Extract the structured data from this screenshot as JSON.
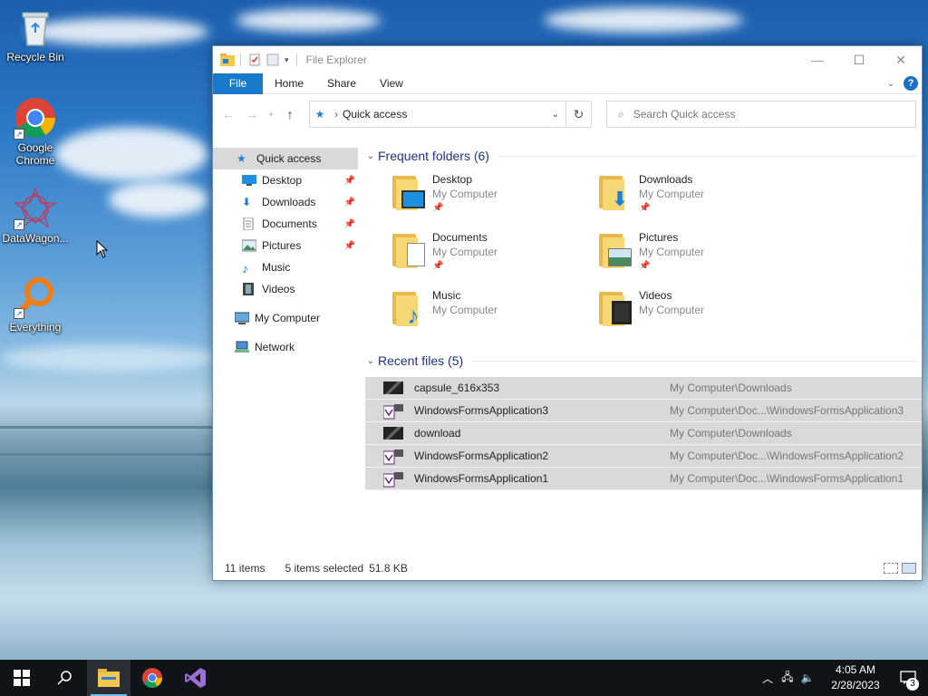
{
  "desktop": {
    "icons": [
      {
        "label": "Recycle Bin"
      },
      {
        "label": "Google Chrome"
      },
      {
        "label": "DataWagon..."
      },
      {
        "label": "Everything"
      }
    ]
  },
  "window": {
    "title": "File Explorer",
    "controls": {
      "minimize": "—",
      "maximize": "☐",
      "close": "✕"
    },
    "ribbon_tabs": [
      "File",
      "Home",
      "Share",
      "View"
    ],
    "help_label": "?",
    "address": {
      "path": "Quick access",
      "separator": "›"
    },
    "search": {
      "placeholder": "Search Quick access"
    },
    "nav_pane": {
      "quick_access": "Quick access",
      "pinned": [
        {
          "label": "Desktop",
          "pinned": true
        },
        {
          "label": "Downloads",
          "pinned": true
        },
        {
          "label": "Documents",
          "pinned": true
        },
        {
          "label": "Pictures",
          "pinned": true
        },
        {
          "label": "Music",
          "pinned": false
        },
        {
          "label": "Videos",
          "pinned": false
        }
      ],
      "my_computer": "My Computer",
      "network": "Network"
    },
    "frequent": {
      "header": "Frequent folders (6)",
      "folders": [
        {
          "name": "Desktop",
          "location": "My Computer",
          "pinned": true
        },
        {
          "name": "Downloads",
          "location": "My Computer",
          "pinned": true
        },
        {
          "name": "Documents",
          "location": "My Computer",
          "pinned": true
        },
        {
          "name": "Pictures",
          "location": "My Computer",
          "pinned": true
        },
        {
          "name": "Music",
          "location": "My Computer",
          "pinned": false
        },
        {
          "name": "Videos",
          "location": "My Computer",
          "pinned": false
        }
      ]
    },
    "recent": {
      "header": "Recent files (5)",
      "files": [
        {
          "name": "capsule_616x353",
          "path": "My Computer\\Downloads",
          "icon": "image-icon"
        },
        {
          "name": "WindowsFormsApplication3",
          "path": "My Computer\\Doc...\\WindowsFormsApplication3",
          "icon": "visual-studio-solution-icon"
        },
        {
          "name": "download",
          "path": "My Computer\\Downloads",
          "icon": "image-icon"
        },
        {
          "name": "WindowsFormsApplication2",
          "path": "My Computer\\Doc...\\WindowsFormsApplication2",
          "icon": "visual-studio-solution-icon"
        },
        {
          "name": "WindowsFormsApplication1",
          "path": "My Computer\\Doc...\\WindowsFormsApplication1",
          "icon": "visual-studio-solution-icon"
        }
      ]
    },
    "status": {
      "items": "11 items",
      "selected": "5 items selected",
      "size": "51.8 KB"
    }
  },
  "taskbar": {
    "clock_time": "4:05 AM",
    "clock_date": "2/28/2023",
    "notification_count": "3"
  }
}
